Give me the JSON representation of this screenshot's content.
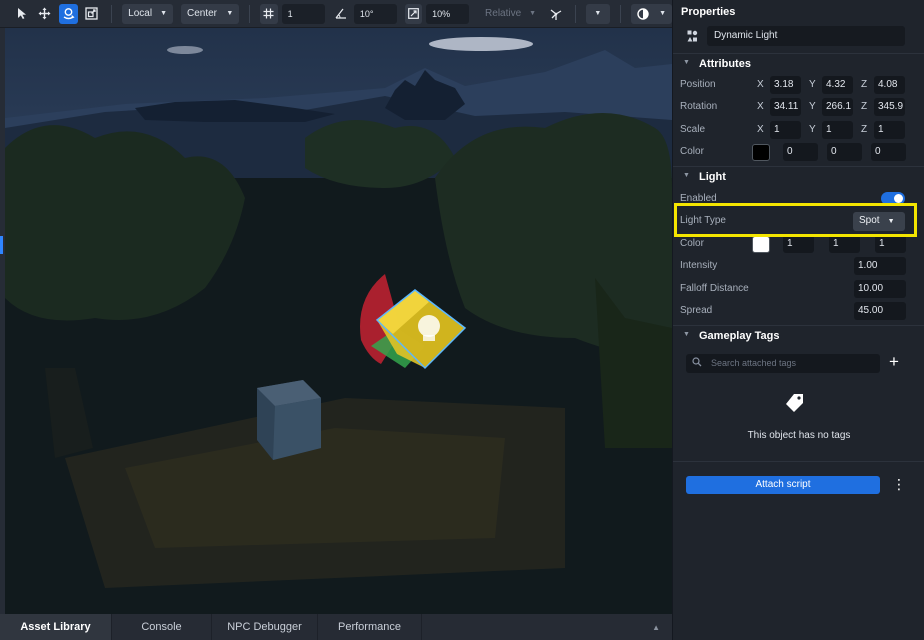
{
  "toolbar": {
    "space_mode": "Local",
    "pivot_mode": "Center",
    "grid_snap": "1",
    "angle_snap": "10°",
    "scale_snap": "10%",
    "relative_label": "Relative"
  },
  "bottom_tabs": [
    {
      "label": "Asset Library",
      "active": true
    },
    {
      "label": "Console",
      "active": false
    },
    {
      "label": "NPC Debugger",
      "active": false
    },
    {
      "label": "Performance",
      "active": false
    }
  ],
  "properties": {
    "title": "Properties",
    "object_name": "Dynamic Light",
    "attributes": {
      "header": "Attributes",
      "position": {
        "label": "Position",
        "x": "3.18",
        "y": "4.32",
        "z": "4.08"
      },
      "rotation": {
        "label": "Rotation",
        "x": "34.11",
        "y": "266.1",
        "z": "345.9"
      },
      "scale": {
        "label": "Scale",
        "x": "1",
        "y": "1",
        "z": "1"
      },
      "color": {
        "label": "Color",
        "swatch": "#000000",
        "r": "0",
        "g": "0",
        "b": "0"
      }
    },
    "light": {
      "header": "Light",
      "enabled_label": "Enabled",
      "enabled": true,
      "type_label": "Light Type",
      "type_value": "Spot",
      "color_label": "Color",
      "color_swatch": "#ffffff",
      "color_r": "1",
      "color_g": "1",
      "color_b": "1",
      "intensity_label": "Intensity",
      "intensity": "1.00",
      "falloff_label": "Falloff Distance",
      "falloff": "10.00",
      "spread_label": "Spread",
      "spread": "45.00"
    },
    "gameplay_tags": {
      "header": "Gameplay Tags",
      "search_placeholder": "Search attached tags",
      "empty_text": "This object has no tags"
    },
    "attach_script_label": "Attach script"
  },
  "axis_labels": {
    "x": "X",
    "y": "Y",
    "z": "Z"
  },
  "colors": {
    "accent": "#1f6fe0",
    "highlight": "#f4e500"
  }
}
